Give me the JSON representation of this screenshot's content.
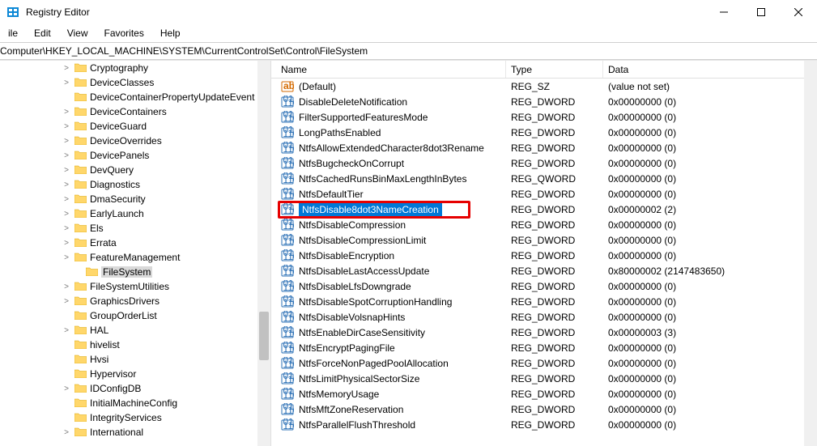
{
  "app": {
    "title": "Registry Editor"
  },
  "menu": {
    "items": [
      "ile",
      "Edit",
      "View",
      "Favorites",
      "Help"
    ]
  },
  "address": {
    "path": "Computer\\HKEY_LOCAL_MACHINE\\SYSTEM\\CurrentControlSet\\Control\\FileSystem"
  },
  "tree": {
    "items": [
      {
        "label": "Cryptography",
        "expander": ">",
        "level": 1
      },
      {
        "label": "DeviceClasses",
        "expander": ">",
        "level": 1
      },
      {
        "label": "DeviceContainerPropertyUpdateEvent",
        "expander": "",
        "level": 1
      },
      {
        "label": "DeviceContainers",
        "expander": ">",
        "level": 1
      },
      {
        "label": "DeviceGuard",
        "expander": ">",
        "level": 1
      },
      {
        "label": "DeviceOverrides",
        "expander": ">",
        "level": 1
      },
      {
        "label": "DevicePanels",
        "expander": ">",
        "level": 1
      },
      {
        "label": "DevQuery",
        "expander": ">",
        "level": 1
      },
      {
        "label": "Diagnostics",
        "expander": ">",
        "level": 1
      },
      {
        "label": "DmaSecurity",
        "expander": ">",
        "level": 1
      },
      {
        "label": "EarlyLaunch",
        "expander": ">",
        "level": 1
      },
      {
        "label": "Els",
        "expander": ">",
        "level": 1
      },
      {
        "label": "Errata",
        "expander": ">",
        "level": 1
      },
      {
        "label": "FeatureManagement",
        "expander": ">",
        "level": 1
      },
      {
        "label": "FileSystem",
        "expander": "",
        "level": 2,
        "selected": true
      },
      {
        "label": "FileSystemUtilities",
        "expander": ">",
        "level": 1
      },
      {
        "label": "GraphicsDrivers",
        "expander": ">",
        "level": 1
      },
      {
        "label": "GroupOrderList",
        "expander": "",
        "level": 1
      },
      {
        "label": "HAL",
        "expander": ">",
        "level": 1
      },
      {
        "label": "hivelist",
        "expander": "",
        "level": 1
      },
      {
        "label": "Hvsi",
        "expander": "",
        "level": 1
      },
      {
        "label": "Hypervisor",
        "expander": "",
        "level": 1
      },
      {
        "label": "IDConfigDB",
        "expander": ">",
        "level": 1
      },
      {
        "label": "InitialMachineConfig",
        "expander": "",
        "level": 1
      },
      {
        "label": "IntegrityServices",
        "expander": "",
        "level": 1
      },
      {
        "label": "International",
        "expander": ">",
        "level": 1
      }
    ]
  },
  "columns": {
    "name": "Name",
    "type": "Type",
    "data": "Data"
  },
  "values": [
    {
      "icon": "string",
      "name": "(Default)",
      "type": "REG_SZ",
      "data": "(value not set)"
    },
    {
      "icon": "bin",
      "name": "DisableDeleteNotification",
      "type": "REG_DWORD",
      "data": "0x00000000 (0)"
    },
    {
      "icon": "bin",
      "name": "FilterSupportedFeaturesMode",
      "type": "REG_DWORD",
      "data": "0x00000000 (0)"
    },
    {
      "icon": "bin",
      "name": "LongPathsEnabled",
      "type": "REG_DWORD",
      "data": "0x00000000 (0)"
    },
    {
      "icon": "bin",
      "name": "NtfsAllowExtendedCharacter8dot3Rename",
      "type": "REG_DWORD",
      "data": "0x00000000 (0)"
    },
    {
      "icon": "bin",
      "name": "NtfsBugcheckOnCorrupt",
      "type": "REG_DWORD",
      "data": "0x00000000 (0)"
    },
    {
      "icon": "bin",
      "name": "NtfsCachedRunsBinMaxLengthInBytes",
      "type": "REG_QWORD",
      "data": "0x00000000 (0)"
    },
    {
      "icon": "bin",
      "name": "NtfsDefaultTier",
      "type": "REG_DWORD",
      "data": "0x00000000 (0)"
    },
    {
      "icon": "bin",
      "name": "NtfsDisable8dot3NameCreation",
      "type": "REG_DWORD",
      "data": "0x00000002 (2)",
      "highlighted": true
    },
    {
      "icon": "bin",
      "name": "NtfsDisableCompression",
      "type": "REG_DWORD",
      "data": "0x00000000 (0)"
    },
    {
      "icon": "bin",
      "name": "NtfsDisableCompressionLimit",
      "type": "REG_DWORD",
      "data": "0x00000000 (0)"
    },
    {
      "icon": "bin",
      "name": "NtfsDisableEncryption",
      "type": "REG_DWORD",
      "data": "0x00000000 (0)"
    },
    {
      "icon": "bin",
      "name": "NtfsDisableLastAccessUpdate",
      "type": "REG_DWORD",
      "data": "0x80000002 (2147483650)"
    },
    {
      "icon": "bin",
      "name": "NtfsDisableLfsDowngrade",
      "type": "REG_DWORD",
      "data": "0x00000000 (0)"
    },
    {
      "icon": "bin",
      "name": "NtfsDisableSpotCorruptionHandling",
      "type": "REG_DWORD",
      "data": "0x00000000 (0)"
    },
    {
      "icon": "bin",
      "name": "NtfsDisableVolsnapHints",
      "type": "REG_DWORD",
      "data": "0x00000000 (0)"
    },
    {
      "icon": "bin",
      "name": "NtfsEnableDirCaseSensitivity",
      "type": "REG_DWORD",
      "data": "0x00000003 (3)"
    },
    {
      "icon": "bin",
      "name": "NtfsEncryptPagingFile",
      "type": "REG_DWORD",
      "data": "0x00000000 (0)"
    },
    {
      "icon": "bin",
      "name": "NtfsForceNonPagedPoolAllocation",
      "type": "REG_DWORD",
      "data": "0x00000000 (0)"
    },
    {
      "icon": "bin",
      "name": "NtfsLimitPhysicalSectorSize",
      "type": "REG_DWORD",
      "data": "0x00000000 (0)"
    },
    {
      "icon": "bin",
      "name": "NtfsMemoryUsage",
      "type": "REG_DWORD",
      "data": "0x00000000 (0)"
    },
    {
      "icon": "bin",
      "name": "NtfsMftZoneReservation",
      "type": "REG_DWORD",
      "data": "0x00000000 (0)"
    },
    {
      "icon": "bin",
      "name": "NtfsParallelFlushThreshold",
      "type": "REG_DWORD",
      "data": "0x00000000 (0)"
    }
  ]
}
